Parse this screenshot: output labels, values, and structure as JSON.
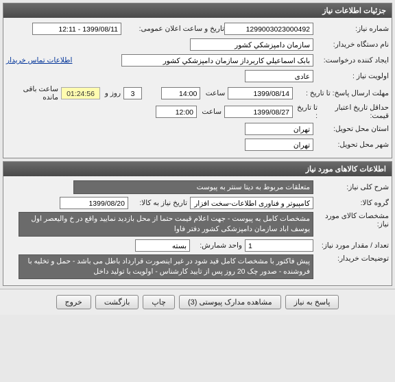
{
  "panel1": {
    "title": "جزئیات اطلاعات نیاز",
    "need_no_label": "شماره نیاز:",
    "need_no": "1299003023000492",
    "public_dt_label": "تاریخ و ساعت اعلان عمومی:",
    "public_dt": "1399/08/11 - 12:11",
    "device_label": "نام دستگاه خریدار:",
    "device": "سازمان دامپزشکي کشور",
    "creator_label": "ایجاد کننده درخواست:",
    "creator": "بابک اسماعیلي کاربرداز سازمان دامپزشکي کشور",
    "contact_link": "اطلاعات تماس خریدار",
    "priority_label": "اولویت نیاز :",
    "priority": "عادی",
    "deadline_reply_label": "مهلت ارسال پاسخ: تا تاریخ :",
    "deadline_reply_date": "1399/08/14",
    "time_label": "ساعت",
    "deadline_reply_time": "14:00",
    "day_count": "3",
    "day_and_label": "روز و",
    "remaining_time": "01:24:56",
    "remaining_label": "ساعت باقی مانده",
    "validity_label": "حداقل تاریخ اعتبار قیمت:",
    "validity_to_label": "تا تاریخ :",
    "validity_date": "1399/08/27",
    "validity_time": "12:00",
    "province_label": "استان محل تحویل:",
    "province": "تهران",
    "city_label": "شهر محل تحویل:",
    "city": "تهران"
  },
  "panel2": {
    "title": "اطلاعات کالاهای مورد نیاز",
    "desc_label": "شرح کلی نیاز:",
    "desc": "متعلقات مربوط به دیتا سنتر به پیوست",
    "group_label": "گروه کالا:",
    "group": "کامپیوتر و فناوری اطلاعات-سخت افزار",
    "need_until_label": "تاریخ نیاز به کالا:",
    "need_until": "1399/08/20",
    "spec_label": "مشخصات کالای مورد نیاز:",
    "spec": "مشخصات کامل به پیوست - جهت اعلام قیمت حتما از محل بازدید نمایید واقع در خ والیعصر اول یوسف اباد سازمان دامپزشکی کشور دفتر فاوا",
    "qty_label": "تعداد / مقدار مورد نیاز:",
    "qty": "1",
    "unit_label": "واحد شمارش:",
    "unit": "بسته",
    "buyer_notes_label": "توضیحات خریدار:",
    "buyer_notes": "پیش فاکتور با مشخصات کامل قید شود در غیر اینصورت قرارداد باطل می باشد - حمل و تخلیه با فروشنده - صدور چک 20 روز پس از تایید کارشناس - اولویت با تولید داخل"
  },
  "buttons": {
    "reply": "پاسخ به نیاز",
    "attachments": "مشاهده مدارک پیوستی (3)",
    "print": "چاپ",
    "back": "بازگشت",
    "exit": "خروج"
  }
}
